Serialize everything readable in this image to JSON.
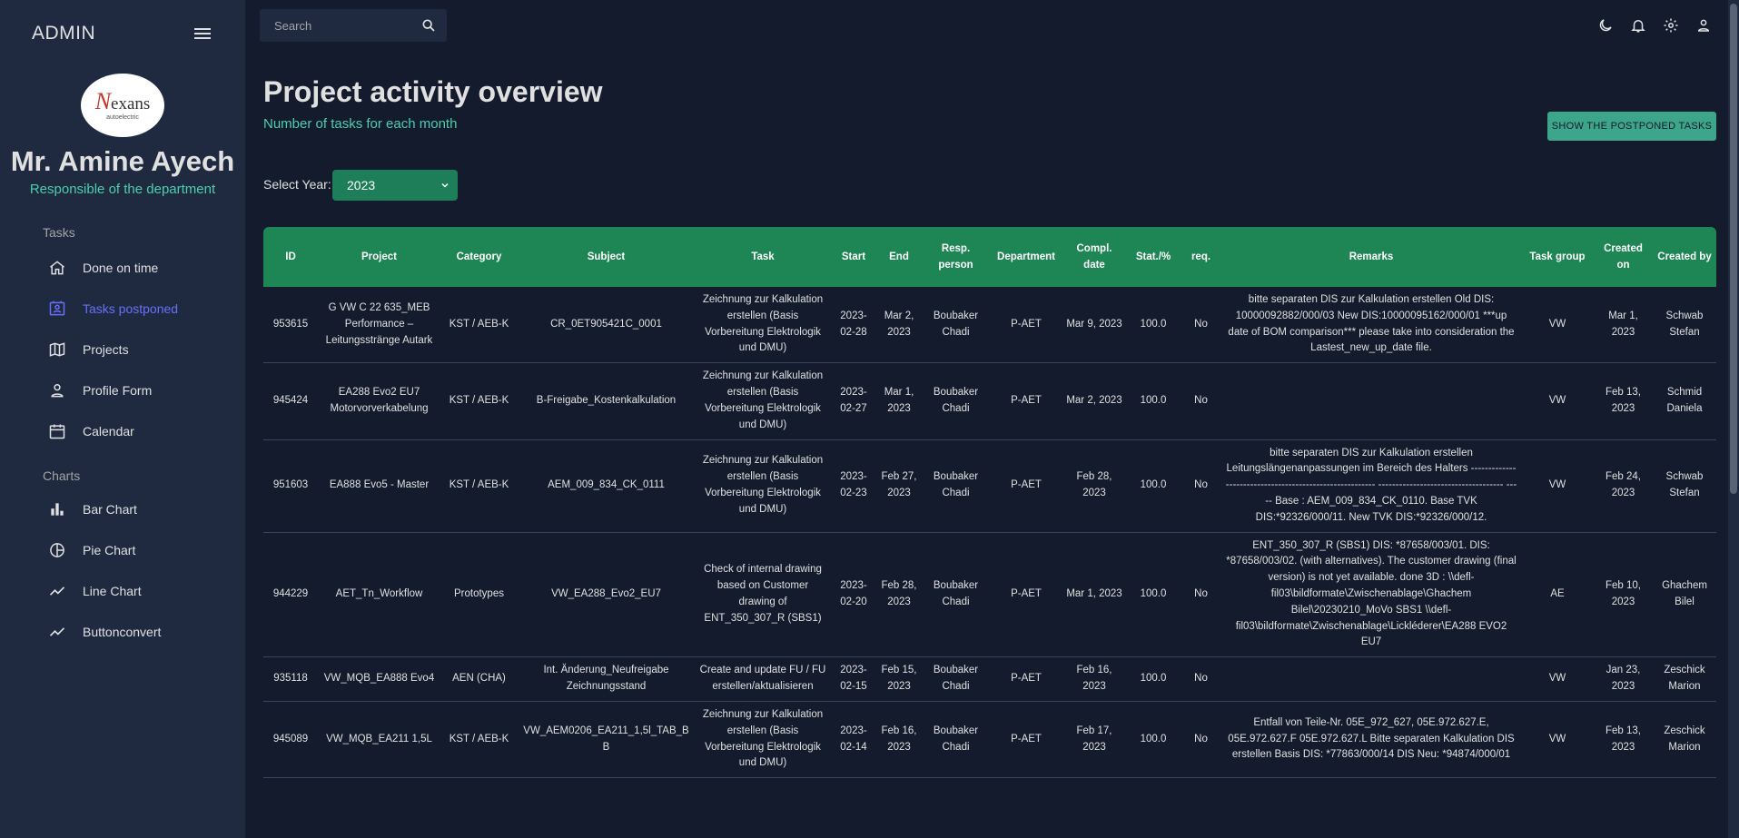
{
  "sidebar": {
    "admin_title": "ADMIN",
    "logo_text": "exans",
    "logo_letter": "N",
    "logo_sub": "autoelectric",
    "user_name": "Mr. Amine Ayech",
    "user_role": "Responsible of the department",
    "sections": [
      {
        "title": "Tasks"
      },
      {
        "title": "Charts"
      }
    ],
    "items": [
      {
        "label": "Done on time",
        "icon": "home-icon"
      },
      {
        "label": "Tasks postponed",
        "icon": "contacts-icon"
      },
      {
        "label": "Projects",
        "icon": "map-icon"
      },
      {
        "label": "Profile Form",
        "icon": "person-icon"
      },
      {
        "label": "Calendar",
        "icon": "calendar-icon"
      },
      {
        "label": "Bar Chart",
        "icon": "bar-chart-icon"
      },
      {
        "label": "Pie Chart",
        "icon": "pie-chart-icon"
      },
      {
        "label": "Line Chart",
        "icon": "line-chart-icon"
      },
      {
        "label": "Buttonconvert",
        "icon": "line-chart-icon"
      }
    ]
  },
  "search": {
    "placeholder": "Search"
  },
  "header": {
    "title": "Project activity overview",
    "subtitle": "Number of tasks for each month",
    "postponed_button": "SHOW THE POSTPONED TASKS",
    "year_label": "Select Year:",
    "year_value": "2023"
  },
  "colors": {
    "accent": "#4cceac",
    "active": "#6870fa",
    "header_bg": "#1e8555",
    "bg": "#141b2d",
    "panel": "#1f2a40"
  },
  "table": {
    "columns": [
      "ID",
      "Project",
      "Category",
      "Subject",
      "Task",
      "Start",
      "End",
      "Resp. person",
      "Department",
      "Compl. date",
      "Stat./%",
      "req.",
      "Remarks",
      "Task group",
      "Created on",
      "Created by"
    ],
    "rows": [
      [
        "953615",
        "G VW C 22 635_MEB Performance – Leitungsstränge Autark",
        "KST / AEB-K",
        "CR_0ET905421C_0001",
        "Zeichnung zur Kalkulation erstellen (Basis Vorbereitung Elektrologik und DMU)",
        "2023-02-28",
        "Mar 2, 2023",
        "Boubaker Chadi",
        "P-AET",
        "Mar 9, 2023",
        "100.0",
        "No",
        "bitte separaten DIS zur Kalkulation erstellen Old DIS: 10000092882/000/03 New DIS:10000095162/000/01 ***up date of BOM comparison*** please take into consideration the Lastest_new_up_date file.",
        "VW",
        "Mar 1, 2023",
        "Schwab Stefan"
      ],
      [
        "945424",
        "EA288 Evo2 EU7 Motorvorverkabelung",
        "KST / AEB-K",
        "B-Freigabe_Kostenkalkulation",
        "Zeichnung zur Kalkulation erstellen (Basis Vorbereitung Elektrologik und DMU)",
        "2023-02-27",
        "Mar 1, 2023",
        "Boubaker Chadi",
        "P-AET",
        "Mar 2, 2023",
        "100.0",
        "No",
        "",
        "VW",
        "Feb 13, 2023",
        "Schmid Daniela"
      ],
      [
        "951603",
        "EA888 Evo5 - Master",
        "KST / AEB-K",
        "AEM_009_834_CK_0111",
        "Zeichnung zur Kalkulation erstellen (Basis Vorbereitung Elektrologik und DMU)",
        "2023-02-23",
        "Feb 27, 2023",
        "Boubaker Chadi",
        "P-AET",
        "Feb 28, 2023",
        "100.0",
        "No",
        "bitte separaten DIS zur Kalkulation erstellen Leitungslängenanpassungen im Bereich des Halters -------------------------------------------------------- ------------------------------------ ----- Base : AEM_009_834_CK_0110. Base TVK DIS:*92326/000/11. New TVK DIS:*92326/000/12.",
        "VW",
        "Feb 24, 2023",
        "Schwab Stefan"
      ],
      [
        "944229",
        "AET_Tn_Workflow",
        "Prototypes",
        "VW_EA288_Evo2_EU7",
        "Check of internal drawing based on Customer drawing of ENT_350_307_R (SBS1)",
        "2023-02-20",
        "Feb 28, 2023",
        "Boubaker Chadi",
        "P-AET",
        "Mar 1, 2023",
        "100.0",
        "No",
        "ENT_350_307_R (SBS1) DIS: *87658/003/01. DIS: *87658/003/02. (with alternatives). The customer drawing (final version) is not yet available. done 3D : \\\\defl-fil03\\bildformate\\Zwischenablage\\Ghachem Bilel\\20230210_MoVo SBS1 \\\\defl-fil03\\bildformate\\Zwischenablage\\Lickléderer\\EA288 EVO2 EU7",
        "AE",
        "Feb 10, 2023",
        "Ghachem Bilel"
      ],
      [
        "935118",
        "VW_MQB_EA888 Evo4",
        "AEN (CHA)",
        "Int. Änderung_Neufreigabe Zeichnungsstand",
        "Create and update FU / FU erstellen/aktualisieren",
        "2023-02-15",
        "Feb 15, 2023",
        "Boubaker Chadi",
        "P-AET",
        "Feb 16, 2023",
        "100.0",
        "No",
        "",
        "VW",
        "Jan 23, 2023",
        "Zeschick Marion"
      ],
      [
        "945089",
        "VW_MQB_EA211 1,5L",
        "KST / AEB-K",
        "VW_AEM0206_EA211_1,5l_TAB_BB",
        "Zeichnung zur Kalkulation erstellen (Basis Vorbereitung Elektrologik und DMU)",
        "2023-02-14",
        "Feb 16, 2023",
        "Boubaker Chadi",
        "P-AET",
        "Feb 17, 2023",
        "100.0",
        "No",
        "Entfall von Teile-Nr. 05E_972_627, 05E.972.627.E, 05E.972.627.F 05E.972.627.L Bitte separaten Kalkulation DIS erstellen Basis DIS: *77863/000/14 DIS Neu: *94874/000/01",
        "VW",
        "Feb 13, 2023",
        "Zeschick Marion"
      ]
    ]
  }
}
